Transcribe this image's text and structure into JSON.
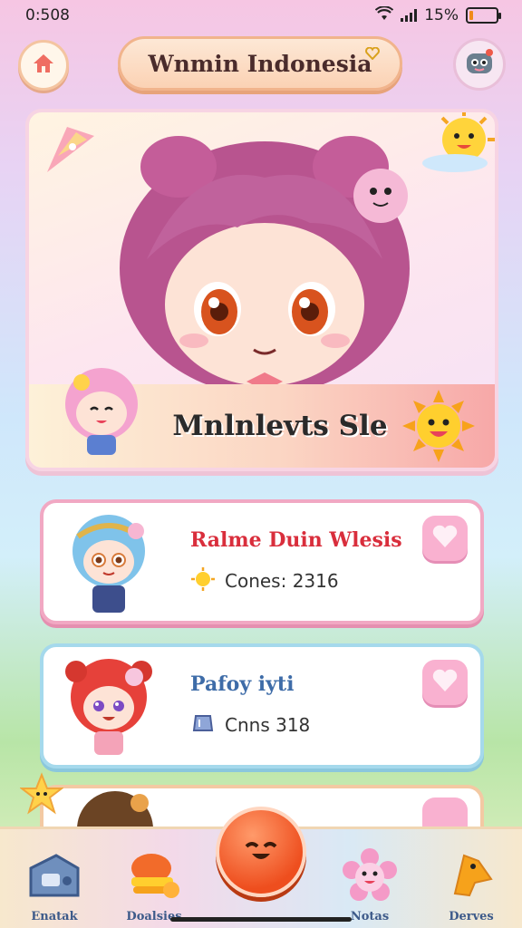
{
  "status_bar": {
    "time": "0:508",
    "battery": "15%",
    "battery_level": 0.15
  },
  "header": {
    "title": "Wnmin Indonesia",
    "home_icon": "home-icon",
    "mascot_icon": "robot-mascot-icon"
  },
  "feature": {
    "name": "Mnlnlevts Sle"
  },
  "characters": [
    {
      "name": "Ralme Duin Wlesis",
      "coins_label": "Cones: 2316",
      "theme": "#f1a8c3"
    },
    {
      "name": "Pafoy iyti",
      "coins_label": "Cnns 318",
      "theme": "#a5d9ec"
    }
  ],
  "nav": {
    "items": [
      {
        "label": "Enatak",
        "icon": "device-icon"
      },
      {
        "label": "Doalsies",
        "icon": "burger-icon"
      },
      {
        "label": "Notas",
        "icon": "flower-icon"
      },
      {
        "label": "Derves",
        "icon": "bird-icon"
      }
    ],
    "center_icon": "orange-face-icon"
  },
  "colors": {
    "accent": "#ee4e1e",
    "pink": "#f1a8c3",
    "blue": "#a5d9ec"
  }
}
